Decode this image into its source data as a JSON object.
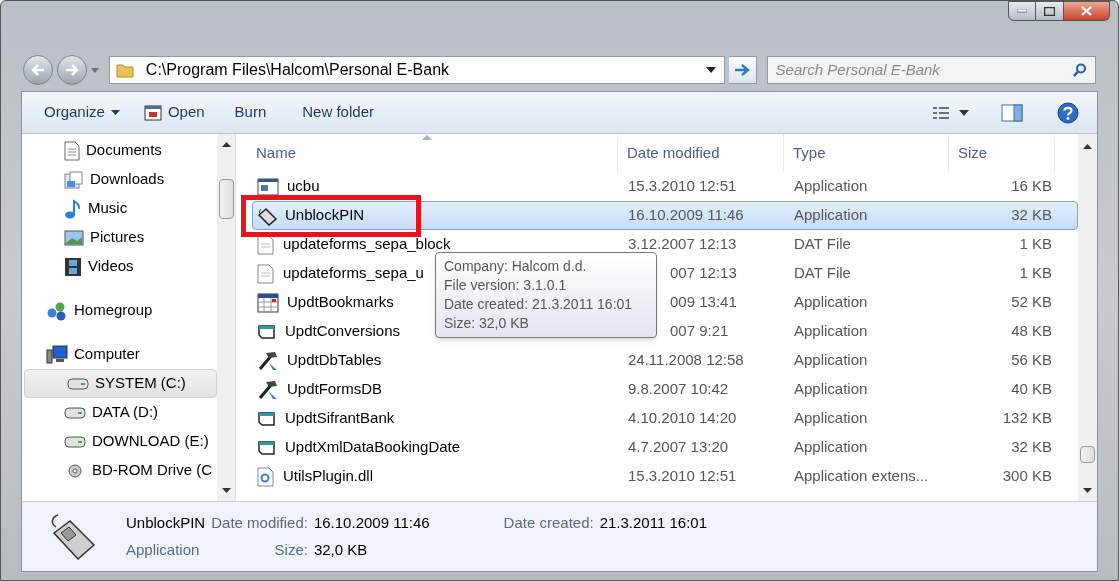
{
  "address": {
    "path": "C:\\Program Files\\Halcom\\Personal E-Bank"
  },
  "search": {
    "placeholder": "Search Personal E-Bank"
  },
  "toolbar": [
    {
      "label": "Organize",
      "kind": "menu"
    },
    {
      "label": "Open",
      "kind": "icon"
    },
    {
      "label": "Burn",
      "kind": "plain"
    },
    {
      "label": "New folder",
      "kind": "plain"
    }
  ],
  "sidebar": {
    "items": [
      {
        "label": "Documents",
        "kind": "sub",
        "selected": false
      },
      {
        "label": "Downloads",
        "kind": "sub",
        "selected": false
      },
      {
        "label": "Music",
        "kind": "sub",
        "selected": false
      },
      {
        "label": "Pictures",
        "kind": "sub",
        "selected": false
      },
      {
        "label": "Videos",
        "kind": "sub",
        "selected": false
      },
      {
        "label": "Homegroup",
        "kind": "top",
        "selected": false
      },
      {
        "label": "Computer",
        "kind": "top",
        "selected": false
      },
      {
        "label": "SYSTEM (C:)",
        "kind": "sub",
        "selected": true
      },
      {
        "label": "DATA (D:)",
        "kind": "sub",
        "selected": false
      },
      {
        "label": "DOWNLOAD (E:)",
        "kind": "sub",
        "selected": false
      },
      {
        "label": "BD-ROM Drive (C",
        "kind": "sub",
        "selected": false
      }
    ]
  },
  "table": {
    "columns": [
      "Name",
      "Date modified",
      "Type",
      "Size"
    ],
    "rows": [
      {
        "name": "ucbu",
        "date": "15.3.2010 12:51",
        "type": "Application",
        "size": "16 KB",
        "selected": false,
        "covered": false
      },
      {
        "name": "UnblockPIN",
        "date": "16.10.2009 11:46",
        "type": "Application",
        "size": "32 KB",
        "selected": true,
        "covered": false
      },
      {
        "name": "updateforms_sepa_block",
        "date": "3.12.2007 12:13",
        "type": "DAT File",
        "size": "1 KB",
        "selected": false,
        "covered": false
      },
      {
        "name": "updateforms_sepa_u",
        "date": "007 12:13",
        "type": "DAT File",
        "size": "1 KB",
        "selected": false,
        "covered": true
      },
      {
        "name": "UpdtBookmarks",
        "date": "009 13:41",
        "type": "Application",
        "size": "52 KB",
        "selected": false,
        "covered": true
      },
      {
        "name": "UpdtConversions",
        "date": "007 9:21",
        "type": "Application",
        "size": "48 KB",
        "selected": false,
        "covered": true
      },
      {
        "name": "UpdtDbTables",
        "date": "24.11.2008 12:58",
        "type": "Application",
        "size": "56 KB",
        "selected": false,
        "covered": false
      },
      {
        "name": "UpdtFormsDB",
        "date": "9.8.2007 10:42",
        "type": "Application",
        "size": "40 KB",
        "selected": false,
        "covered": false
      },
      {
        "name": "UpdtSifrantBank",
        "date": "4.10.2010 14:20",
        "type": "Application",
        "size": "132 KB",
        "selected": false,
        "covered": false
      },
      {
        "name": "UpdtXmlDataBookingDate",
        "date": "4.7.2007 13:20",
        "type": "Application",
        "size": "32 KB",
        "selected": false,
        "covered": false
      },
      {
        "name": "UtilsPlugin.dll",
        "date": "15.3.2010 12:51",
        "type": "Application extens...",
        "size": "300 KB",
        "selected": false,
        "covered": false
      }
    ]
  },
  "tooltip": [
    "Company: Halcom d.d.",
    "File version: 3.1.0.1",
    "Date created: 21.3.2011 16:01",
    "Size: 32,0 KB"
  ],
  "details": {
    "name": "UnblockPIN",
    "type": "Application",
    "fields": [
      {
        "label": "Date modified:",
        "value": "16.10.2009 11:46"
      },
      {
        "label": "Size:",
        "value": "32,0 KB"
      },
      {
        "label": "Date created:",
        "value": "21.3.2011 16:01"
      }
    ]
  }
}
